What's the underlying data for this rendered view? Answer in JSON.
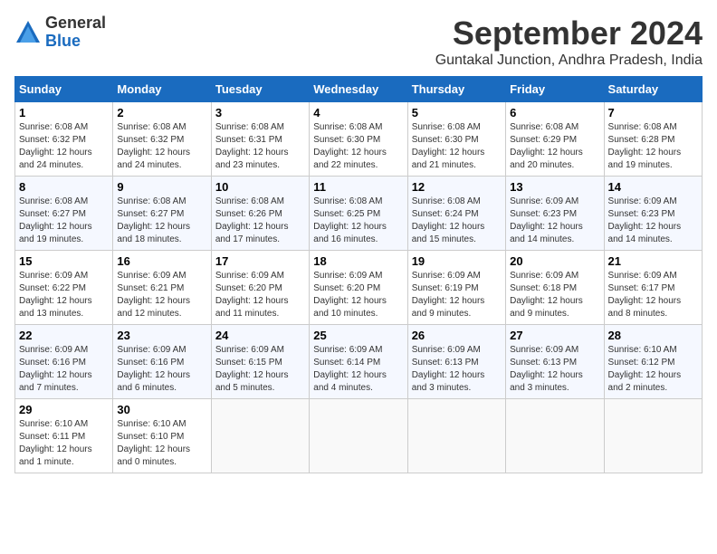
{
  "logo": {
    "general": "General",
    "blue": "Blue"
  },
  "title": "September 2024",
  "location": "Guntakal Junction, Andhra Pradesh, India",
  "days_header": [
    "Sunday",
    "Monday",
    "Tuesday",
    "Wednesday",
    "Thursday",
    "Friday",
    "Saturday"
  ],
  "weeks": [
    [
      {
        "day": "1",
        "info": "Sunrise: 6:08 AM\nSunset: 6:32 PM\nDaylight: 12 hours\nand 24 minutes."
      },
      {
        "day": "2",
        "info": "Sunrise: 6:08 AM\nSunset: 6:32 PM\nDaylight: 12 hours\nand 24 minutes."
      },
      {
        "day": "3",
        "info": "Sunrise: 6:08 AM\nSunset: 6:31 PM\nDaylight: 12 hours\nand 23 minutes."
      },
      {
        "day": "4",
        "info": "Sunrise: 6:08 AM\nSunset: 6:30 PM\nDaylight: 12 hours\nand 22 minutes."
      },
      {
        "day": "5",
        "info": "Sunrise: 6:08 AM\nSunset: 6:30 PM\nDaylight: 12 hours\nand 21 minutes."
      },
      {
        "day": "6",
        "info": "Sunrise: 6:08 AM\nSunset: 6:29 PM\nDaylight: 12 hours\nand 20 minutes."
      },
      {
        "day": "7",
        "info": "Sunrise: 6:08 AM\nSunset: 6:28 PM\nDaylight: 12 hours\nand 19 minutes."
      }
    ],
    [
      {
        "day": "8",
        "info": "Sunrise: 6:08 AM\nSunset: 6:27 PM\nDaylight: 12 hours\nand 19 minutes."
      },
      {
        "day": "9",
        "info": "Sunrise: 6:08 AM\nSunset: 6:27 PM\nDaylight: 12 hours\nand 18 minutes."
      },
      {
        "day": "10",
        "info": "Sunrise: 6:08 AM\nSunset: 6:26 PM\nDaylight: 12 hours\nand 17 minutes."
      },
      {
        "day": "11",
        "info": "Sunrise: 6:08 AM\nSunset: 6:25 PM\nDaylight: 12 hours\nand 16 minutes."
      },
      {
        "day": "12",
        "info": "Sunrise: 6:08 AM\nSunset: 6:24 PM\nDaylight: 12 hours\nand 15 minutes."
      },
      {
        "day": "13",
        "info": "Sunrise: 6:09 AM\nSunset: 6:23 PM\nDaylight: 12 hours\nand 14 minutes."
      },
      {
        "day": "14",
        "info": "Sunrise: 6:09 AM\nSunset: 6:23 PM\nDaylight: 12 hours\nand 14 minutes."
      }
    ],
    [
      {
        "day": "15",
        "info": "Sunrise: 6:09 AM\nSunset: 6:22 PM\nDaylight: 12 hours\nand 13 minutes."
      },
      {
        "day": "16",
        "info": "Sunrise: 6:09 AM\nSunset: 6:21 PM\nDaylight: 12 hours\nand 12 minutes."
      },
      {
        "day": "17",
        "info": "Sunrise: 6:09 AM\nSunset: 6:20 PM\nDaylight: 12 hours\nand 11 minutes."
      },
      {
        "day": "18",
        "info": "Sunrise: 6:09 AM\nSunset: 6:20 PM\nDaylight: 12 hours\nand 10 minutes."
      },
      {
        "day": "19",
        "info": "Sunrise: 6:09 AM\nSunset: 6:19 PM\nDaylight: 12 hours\nand 9 minutes."
      },
      {
        "day": "20",
        "info": "Sunrise: 6:09 AM\nSunset: 6:18 PM\nDaylight: 12 hours\nand 9 minutes."
      },
      {
        "day": "21",
        "info": "Sunrise: 6:09 AM\nSunset: 6:17 PM\nDaylight: 12 hours\nand 8 minutes."
      }
    ],
    [
      {
        "day": "22",
        "info": "Sunrise: 6:09 AM\nSunset: 6:16 PM\nDaylight: 12 hours\nand 7 minutes."
      },
      {
        "day": "23",
        "info": "Sunrise: 6:09 AM\nSunset: 6:16 PM\nDaylight: 12 hours\nand 6 minutes."
      },
      {
        "day": "24",
        "info": "Sunrise: 6:09 AM\nSunset: 6:15 PM\nDaylight: 12 hours\nand 5 minutes."
      },
      {
        "day": "25",
        "info": "Sunrise: 6:09 AM\nSunset: 6:14 PM\nDaylight: 12 hours\nand 4 minutes."
      },
      {
        "day": "26",
        "info": "Sunrise: 6:09 AM\nSunset: 6:13 PM\nDaylight: 12 hours\nand 3 minutes."
      },
      {
        "day": "27",
        "info": "Sunrise: 6:09 AM\nSunset: 6:13 PM\nDaylight: 12 hours\nand 3 minutes."
      },
      {
        "day": "28",
        "info": "Sunrise: 6:10 AM\nSunset: 6:12 PM\nDaylight: 12 hours\nand 2 minutes."
      }
    ],
    [
      {
        "day": "29",
        "info": "Sunrise: 6:10 AM\nSunset: 6:11 PM\nDaylight: 12 hours\nand 1 minute."
      },
      {
        "day": "30",
        "info": "Sunrise: 6:10 AM\nSunset: 6:10 PM\nDaylight: 12 hours\nand 0 minutes."
      },
      null,
      null,
      null,
      null,
      null
    ]
  ]
}
